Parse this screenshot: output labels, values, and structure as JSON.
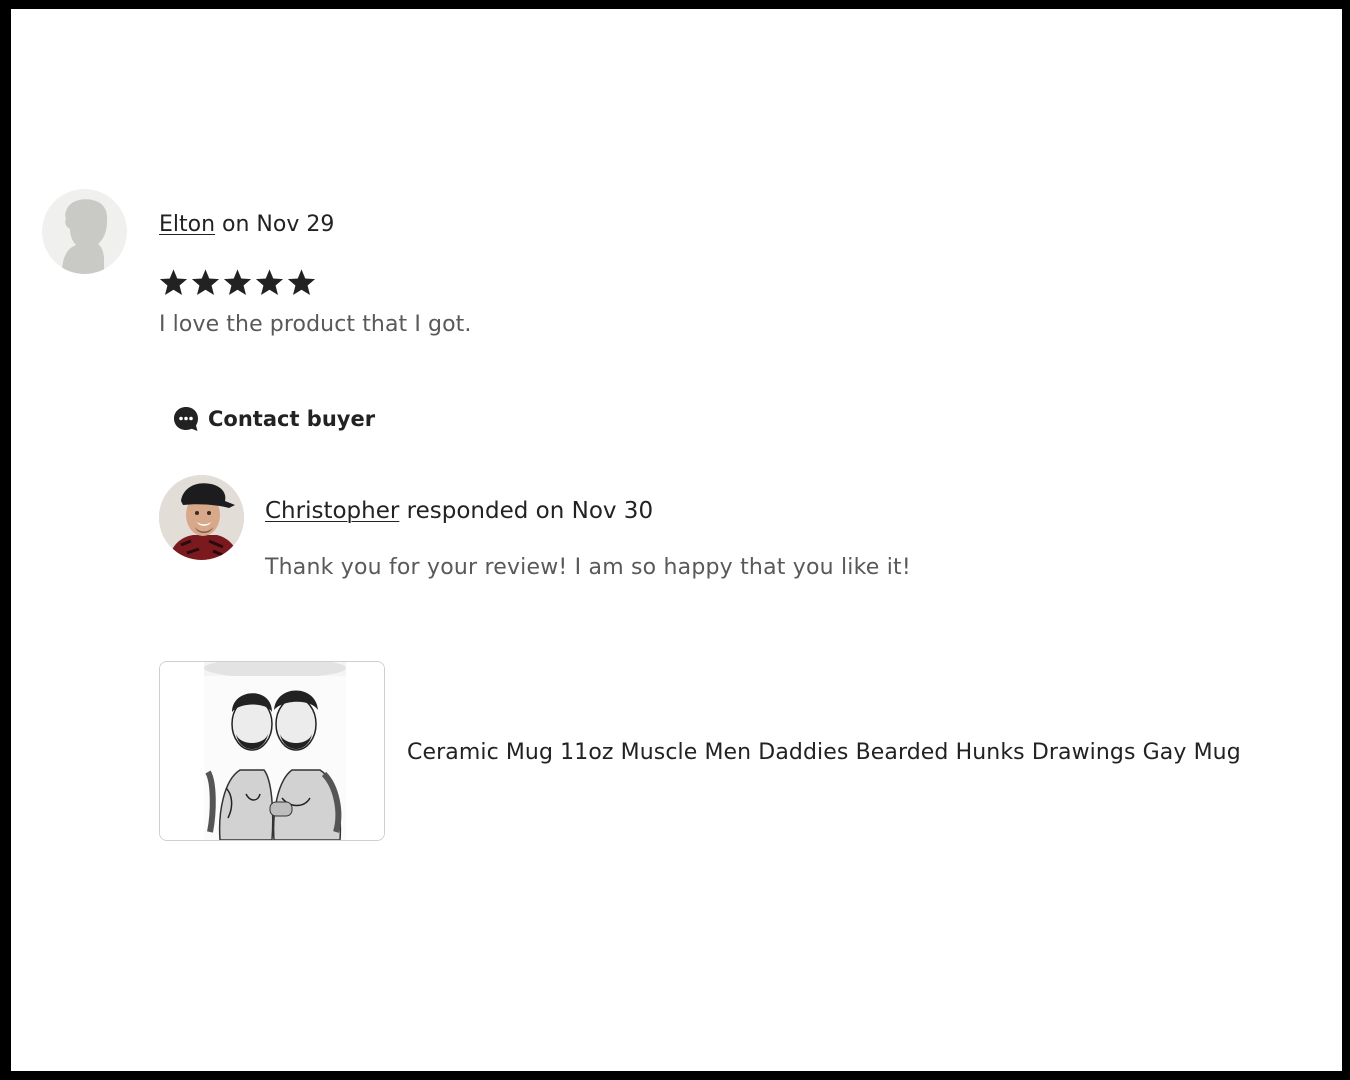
{
  "review": {
    "reviewer_name": "Elton",
    "date_text": " on Nov 29",
    "rating": 5,
    "rating_max": 5,
    "text": "I love the product that I got."
  },
  "contact": {
    "label": "Contact buyer",
    "icon": "chat-bubble-icon"
  },
  "response": {
    "responder_name": "Christopher",
    "date_text": " responded on Nov 30",
    "text": "Thank you for your review! I am so happy that you like it!"
  },
  "product": {
    "title": "Ceramic Mug 11oz Muscle Men Daddies Bearded Hunks Drawings Gay Mug"
  },
  "colors": {
    "text_primary": "#222222",
    "text_secondary": "#595959",
    "star": "#222222",
    "frame": "#000000"
  }
}
